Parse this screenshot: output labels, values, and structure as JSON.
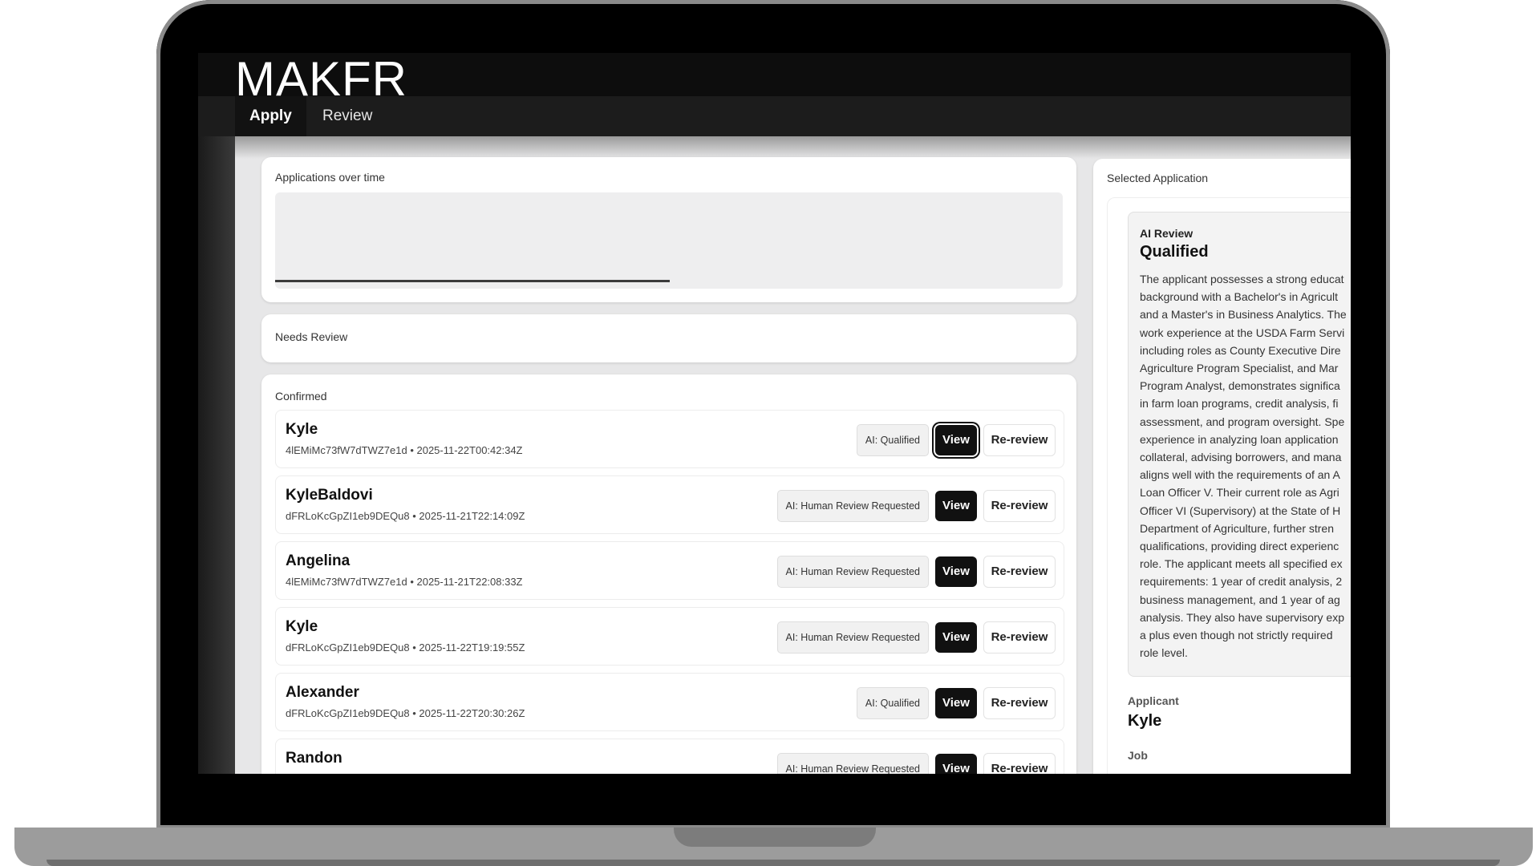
{
  "app": {
    "brand": "MAKFR"
  },
  "nav": {
    "tabs": [
      {
        "label": "Apply"
      },
      {
        "label": "Review"
      }
    ]
  },
  "chart": {
    "label": "Applications over time"
  },
  "needs_review": {
    "label": "Needs Review"
  },
  "confirmed": {
    "label": "Confirmed",
    "rows": [
      {
        "name": "Kyle",
        "meta": "4lEMiMc73fW7dTWZ7e1d • 2025-11-22T00:42:34Z",
        "badge": "AI: Qualified",
        "view": "View",
        "rereview": "Re-review"
      },
      {
        "name": "KyleBaldovi",
        "meta": "dFRLoKcGpZI1eb9DEQu8 • 2025-11-21T22:14:09Z",
        "badge": "AI: Human Review Requested",
        "view": "View",
        "rereview": "Re-review"
      },
      {
        "name": "Angelina",
        "meta": "4lEMiMc73fW7dTWZ7e1d • 2025-11-21T22:08:33Z",
        "badge": "AI: Human Review Requested",
        "view": "View",
        "rereview": "Re-review"
      },
      {
        "name": "Kyle",
        "meta": "dFRLoKcGpZI1eb9DEQu8 • 2025-11-22T19:19:55Z",
        "badge": "AI: Human Review Requested",
        "view": "View",
        "rereview": "Re-review"
      },
      {
        "name": "Alexander",
        "meta": "dFRLoKcGpZI1eb9DEQu8 • 2025-11-22T20:30:26Z",
        "badge": "AI: Qualified",
        "view": "View",
        "rereview": "Re-review"
      },
      {
        "name": "Randon",
        "meta": "",
        "badge": "AI: Human Review Requested",
        "view": "View",
        "rereview": "Re-review"
      }
    ]
  },
  "selected": {
    "label": "Selected Application",
    "ai_review_label": "AI Review",
    "ai_review_result": "Qualified",
    "ai_review_text": "The applicant possesses a strong educat\nbackground with a Bachelor's in Agricult\nand a Master's in Business Analytics. The\nwork experience at the USDA Farm Servi\nincluding roles as County Executive Dire\nAgriculture Program Specialist, and Mar\nProgram Analyst, demonstrates significa\nin farm loan programs, credit analysis, fi\nassessment, and program oversight. Spe\nexperience in analyzing loan application\ncollateral, advising borrowers, and mana\naligns well with the requirements of an A\nLoan Officer V. Their current role as Agri\nOfficer VI (Supervisory) at the State of H\nDepartment of Agriculture, further stren\nqualifications, providing direct experienc\nrole. The applicant meets all specified ex\nrequirements: 1 year of credit analysis, 2\nbusiness management, and 1 year of ag\nanalysis. They also have supervisory exp\na plus even though not strictly required\nrole level.",
    "applicant_label": "Applicant",
    "applicant_value": "Kyle",
    "job_label": "Job"
  }
}
